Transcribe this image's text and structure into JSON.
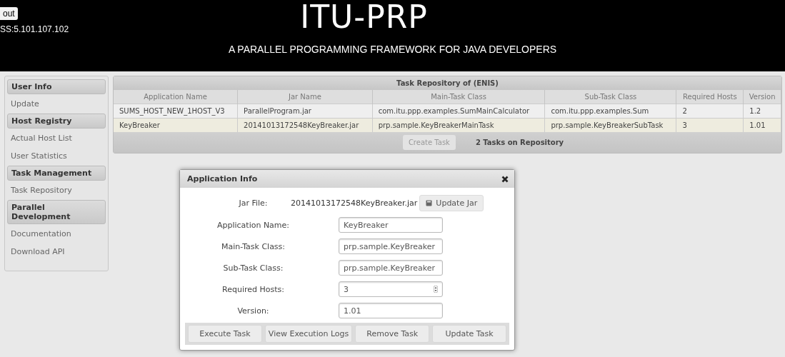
{
  "header": {
    "logout_button": "out",
    "address": "SS:5.101.107.102",
    "title": "ITU-PRP",
    "subtitle": "A PARALLEL PROGRAMMING FRAMEWORK FOR JAVA DEVELOPERS"
  },
  "sidebar": {
    "items": [
      {
        "kind": "heading",
        "label": "User Info"
      },
      {
        "kind": "link",
        "label": "Update"
      },
      {
        "kind": "heading",
        "label": "Host Registry"
      },
      {
        "kind": "link",
        "label": "Actual Host List"
      },
      {
        "kind": "link",
        "label": "User Statistics"
      },
      {
        "kind": "heading",
        "label": "Task Management"
      },
      {
        "kind": "link",
        "label": "Task Repository"
      },
      {
        "kind": "heading",
        "label": "Parallel Development"
      },
      {
        "kind": "link",
        "label": "Documentation"
      },
      {
        "kind": "link",
        "label": "Download API"
      }
    ]
  },
  "table": {
    "title": "Task Repository of (ENIS)",
    "columns": [
      "Application Name",
      "Jar Name",
      "Main-Task Class",
      "Sub-Task Class",
      "Required Hosts",
      "Version"
    ],
    "rows": [
      {
        "selected": false,
        "cells": [
          "SUMS_HOST_NEW_1HOST_V3",
          "ParallelProgram.jar",
          "com.itu.ppp.examples.SumMainCalculator",
          "com.itu.ppp.examples.Sum",
          "2",
          "1.2"
        ]
      },
      {
        "selected": true,
        "cells": [
          "KeyBreaker",
          "20141013172548KeyBreaker.jar",
          "prp.sample.KeyBreakerMainTask",
          "prp.sample.KeyBreakerSubTask",
          "3",
          "1.01"
        ]
      }
    ],
    "create_button": "Create Task",
    "count": "2 Tasks on Repository"
  },
  "dialog": {
    "title": "Application Info",
    "jar_label": "Jar File:",
    "jar_file": "20141013172548KeyBreaker.jar",
    "update_jar_button": "Update Jar",
    "fields": [
      {
        "kind": "text",
        "label": "Application Name:",
        "value": "KeyBreaker"
      },
      {
        "kind": "text",
        "label": "Main-Task Class:",
        "value": "prp.sample.KeyBreaker"
      },
      {
        "kind": "text",
        "label": "Sub-Task Class:",
        "value": "prp.sample.KeyBreaker"
      },
      {
        "kind": "number",
        "label": "Required Hosts:",
        "value": "3"
      },
      {
        "kind": "text",
        "label": "Version:",
        "value": "1.01"
      }
    ],
    "buttons": [
      "Execute Task",
      "View Execution Logs",
      "Remove Task",
      "Update Task"
    ]
  }
}
